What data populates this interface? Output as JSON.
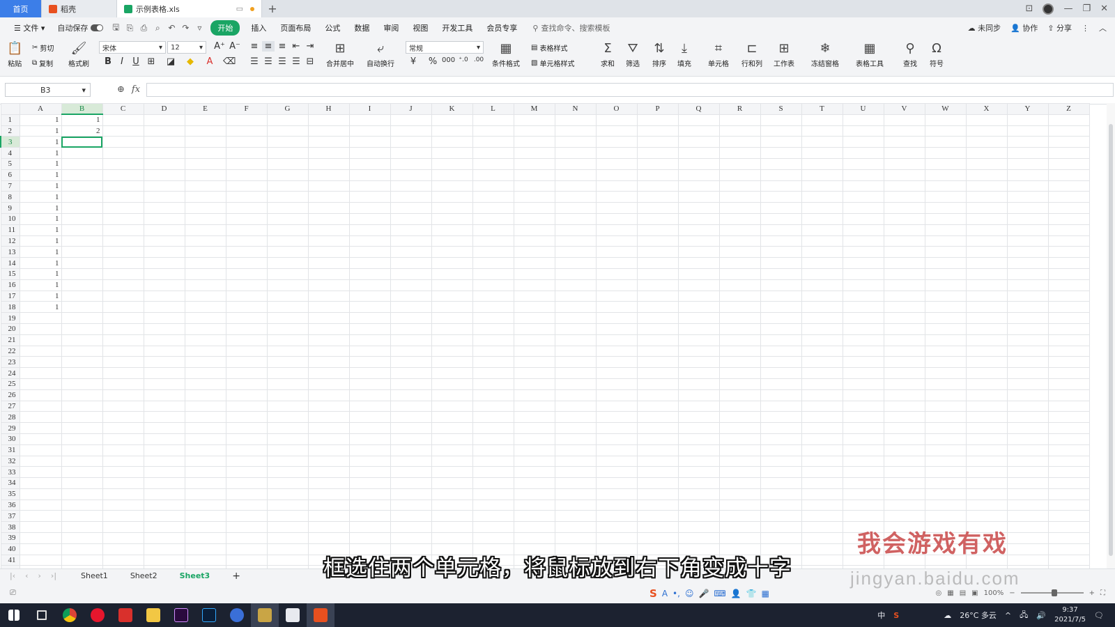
{
  "titlebar": {
    "tabs": [
      {
        "label": "首页"
      },
      {
        "label": "稻壳"
      },
      {
        "label": "示例表格.xls"
      }
    ]
  },
  "menubar": {
    "file": "文件",
    "autosave": "自动保存",
    "items": [
      "开始",
      "插入",
      "页面布局",
      "公式",
      "数据",
      "审阅",
      "视图",
      "开发工具",
      "会员专享"
    ],
    "search": "查找命令、搜索模板",
    "right": [
      "未同步",
      "协作",
      "分享"
    ]
  },
  "ribbon": {
    "paste": "粘贴",
    "cut": "剪切",
    "copy": "复制",
    "format_painter": "格式刷",
    "font_name": "宋体",
    "font_size": "12",
    "merge": "合并居中",
    "wrap": "自动换行",
    "number_format": "常规",
    "cond_format": "条件格式",
    "table_style": "表格样式",
    "cell_style": "单元格样式",
    "sum": "求和",
    "filter": "筛选",
    "sort": "排序",
    "fill": "填充",
    "cell": "单元格",
    "row_col": "行和列",
    "worksheet": "工作表",
    "freeze": "冻结窗格",
    "table_tools": "表格工具",
    "find": "查找",
    "symbol": "符号"
  },
  "formula_bar": {
    "name_box": "B3",
    "fx": "fx",
    "value": ""
  },
  "grid": {
    "columns": [
      "A",
      "B",
      "C",
      "D",
      "E",
      "F",
      "G",
      "H",
      "I",
      "J",
      "K",
      "L",
      "M",
      "N",
      "O",
      "P",
      "Q",
      "R",
      "S",
      "T",
      "U",
      "V",
      "W",
      "X",
      "Y",
      "Z"
    ],
    "selected_column": "B",
    "selected_row": 3,
    "rows": 42,
    "col_a_values": [
      1,
      1,
      1,
      1,
      1,
      1,
      1,
      1,
      1,
      1,
      1,
      1,
      1,
      1,
      1,
      1,
      1,
      1
    ],
    "col_b_values": [
      1,
      2
    ]
  },
  "sheets": {
    "tabs": [
      "Sheet1",
      "Sheet2",
      "Sheet3"
    ],
    "active": "Sheet3"
  },
  "statusbar": {
    "zoom": "100%"
  },
  "subtitle": "框选住两个单元格，将鼠标放到右下角变成十字",
  "watermark": {
    "line1": "我会游戏有戏",
    "line2": "jingyan.baidu.com"
  },
  "taskbar": {
    "temp": "26°C 多云",
    "time": "9:37",
    "date": "2021/7/5",
    "lang": "中"
  },
  "colors": {
    "accent": "#1aa564",
    "home_tab": "#3c7ee8",
    "taskbar": "#1c2230"
  }
}
